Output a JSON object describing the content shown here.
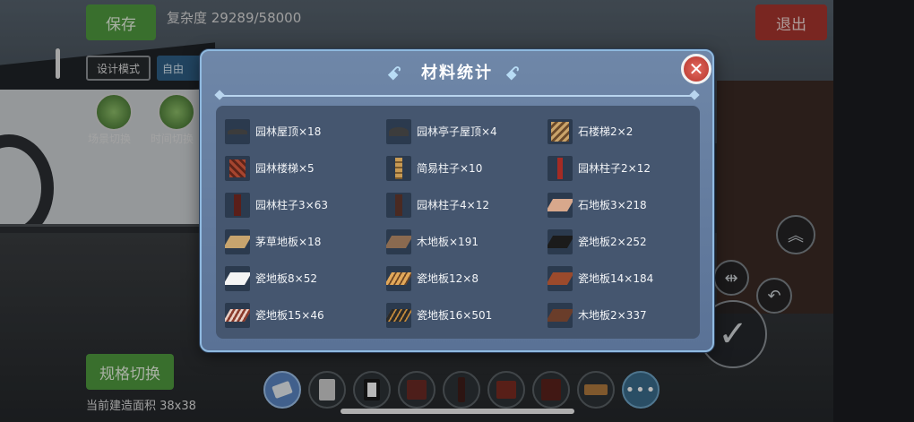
{
  "hud": {
    "save_label": "保存",
    "complexity_text": "复杂度 29289/58000",
    "exit_label": "退出",
    "design_mode_label": "设计模式",
    "free_label": "自由",
    "scene_switch_label": "场景切换",
    "time_switch_label": "时间切换",
    "spec_switch_label": "规格切换",
    "build_area_text": "当前建造面积 38x38"
  },
  "modal": {
    "title": "材料统计",
    "close_icon": "close-icon",
    "items": [
      {
        "label": "园林屋顶×18",
        "icon": "roof"
      },
      {
        "label": "园林亭子屋顶×4",
        "icon": "roof"
      },
      {
        "label": "石楼梯2×2",
        "icon": "stone-stair"
      },
      {
        "label": "园林楼梯×5",
        "icon": "red-stair"
      },
      {
        "label": "简易柱子×10",
        "icon": "wood-pillar"
      },
      {
        "label": "园林柱子2×12",
        "icon": "red-pillar"
      },
      {
        "label": "园林柱子3×63",
        "icon": "dark-red-pillar"
      },
      {
        "label": "园林柱子4×12",
        "icon": "dark-pillar"
      },
      {
        "label": "石地板3×218",
        "icon": "stone-floor"
      },
      {
        "label": "茅草地板×18",
        "icon": "thatch-floor"
      },
      {
        "label": "木地板×191",
        "icon": "wood-floor"
      },
      {
        "label": "瓷地板2×252",
        "icon": "black-tile"
      },
      {
        "label": "瓷地板8×52",
        "icon": "white-tile"
      },
      {
        "label": "瓷地板12×8",
        "icon": "pattern-tile"
      },
      {
        "label": "瓷地板14×184",
        "icon": "brown-tile"
      },
      {
        "label": "瓷地板15×46",
        "icon": "dotted-tile"
      },
      {
        "label": "瓷地板16×501",
        "icon": "dark-pattern-tile"
      },
      {
        "label": "木地板2×337",
        "icon": "dark-wood-floor"
      }
    ]
  },
  "hotbar": {
    "more_label": "•••"
  },
  "colors": {
    "modal_bg": "#6f87a8",
    "panel_bg": "#45566f",
    "save_green": "#4f9a3f",
    "exit_red": "#a8352f",
    "close_red": "#d04a3f"
  }
}
